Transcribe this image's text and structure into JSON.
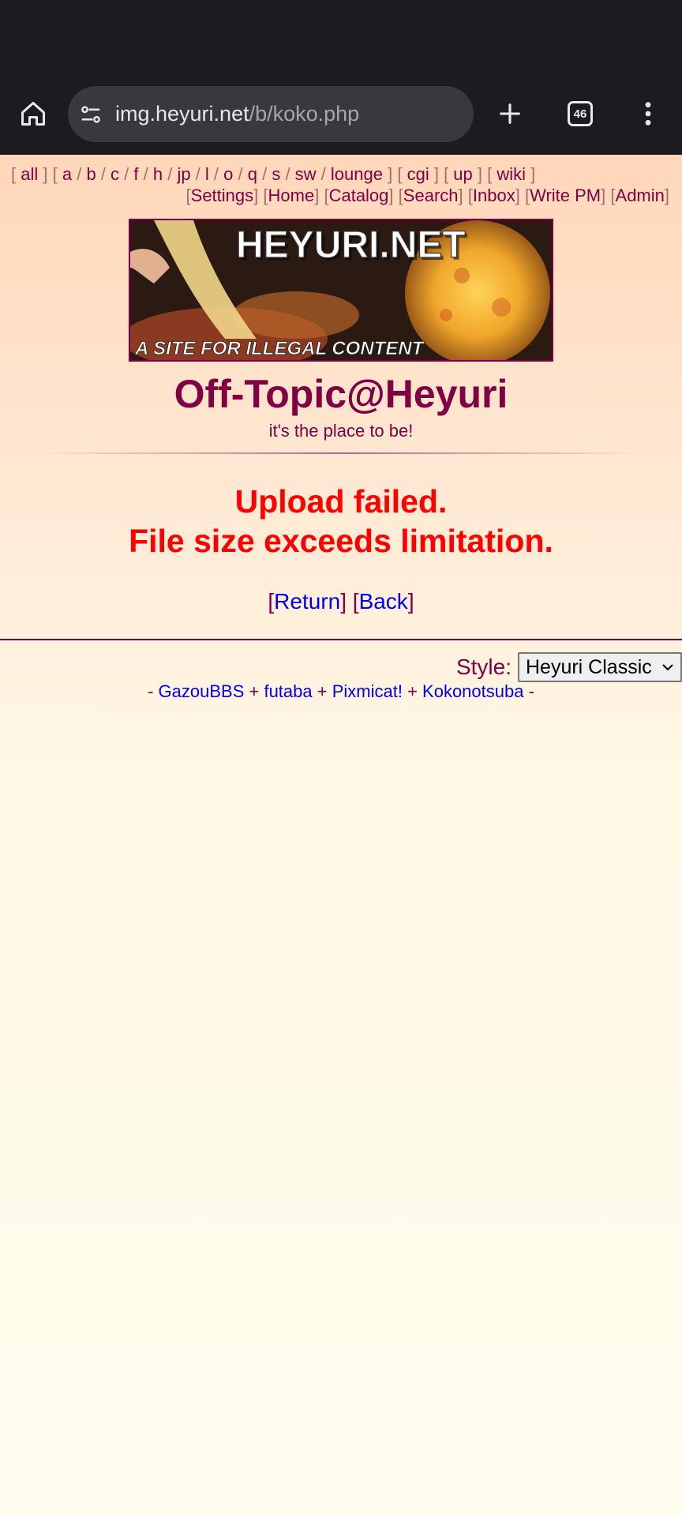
{
  "browser": {
    "url_host": "img.heyuri.net",
    "url_path": "/b/koko.php",
    "tab_count": "46",
    "icons": [
      "home-icon",
      "site-settings-icon",
      "new-tab-icon",
      "tab-switcher-icon",
      "more-vert-icon"
    ]
  },
  "boards": {
    "groups": [
      [
        "all"
      ],
      [
        "a",
        "b",
        "c",
        "f",
        "h",
        "jp",
        "l",
        "o",
        "q",
        "s",
        "sw",
        "lounge"
      ],
      [
        "cgi"
      ],
      [
        "up"
      ],
      [
        "wiki"
      ]
    ]
  },
  "toplinks": [
    "Settings",
    "Home",
    "Catalog",
    "Search",
    "Inbox",
    "Write PM",
    "Admin"
  ],
  "banner": {
    "title": "HEYURI.NET",
    "tagline": "A SITE FOR ILLEGAL CONTENT"
  },
  "board": {
    "title": "Off-Topic@Heyuri",
    "subtitle": "it's the place to be!"
  },
  "error": {
    "line1": "Upload failed.",
    "line2": "File size exceeds limitation."
  },
  "nav": {
    "return_label": "Return",
    "back_label": "Back"
  },
  "style": {
    "label": "Style:",
    "selected": "Heyuri Classic"
  },
  "footer": {
    "links": [
      "GazouBBS",
      "futaba",
      "Pixmicat!",
      "Kokonotsuba"
    ]
  },
  "colors": {
    "text": "#800043",
    "link": "#0000ee",
    "error": "#ff0000",
    "chrome_bg": "#1c1c20"
  }
}
